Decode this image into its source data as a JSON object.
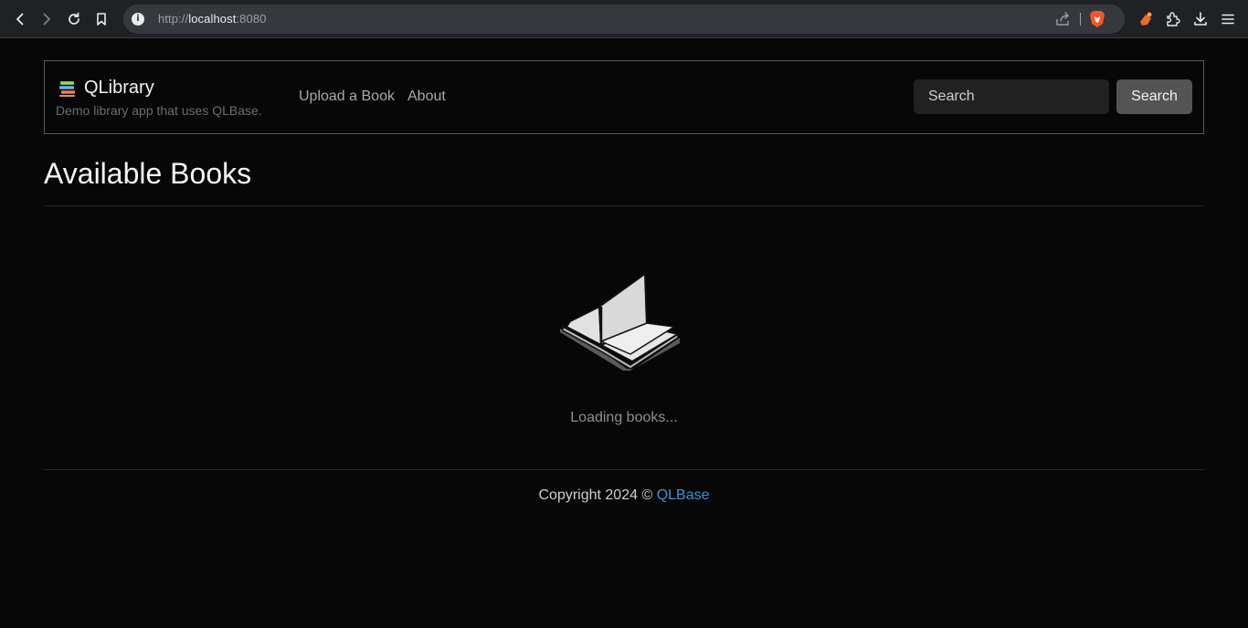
{
  "browser": {
    "url_scheme": "http://",
    "url_host": "localhost",
    "url_port": ":8080",
    "accent": "#202124"
  },
  "navbar": {
    "brand_title": "QLibrary",
    "brand_subtitle": "Demo library app that uses QLBase.",
    "links": [
      "Upload a Book",
      "About"
    ],
    "search_placeholder": "Search",
    "search_button": "Search"
  },
  "main": {
    "title": "Available Books",
    "loading_text": "Loading books..."
  },
  "footer": {
    "copyright": "Copyright 2024 ©",
    "link_text": "QLBase",
    "link_color": "#3d94d6"
  },
  "icons": [
    "back-icon",
    "forward-icon",
    "reload-icon",
    "bookmark-icon",
    "info-icon",
    "share-icon",
    "brave-shield-icon",
    "brave-rewards-icon",
    "extensions-icon",
    "download-icon",
    "menu-icon",
    "books-logo-icon",
    "open-book-illustration"
  ]
}
